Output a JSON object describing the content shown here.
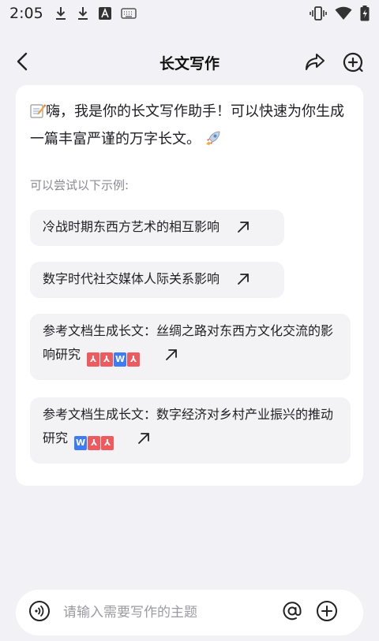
{
  "status_bar": {
    "time": "2:05",
    "left_icons": [
      "download-icon",
      "download-icon",
      "text-a-icon",
      "keyboard-icon"
    ],
    "right_icons": [
      "vibrate-icon",
      "wifi-icon",
      "battery-charging-icon"
    ]
  },
  "header": {
    "title": "长文写作",
    "back_icon": "chevron-left-icon",
    "share_icon": "share-icon",
    "new_chat_icon": "new-chat-icon"
  },
  "intro": {
    "emoji": "memo-emoji",
    "text": "嗨，我是你的长文写作助手！可以快速为你生成一篇丰富严谨的万字长文。",
    "trailing_emoji": "rocket-emoji"
  },
  "examples": {
    "label": "可以尝试以下示例:",
    "items": [
      {
        "text": "冷战时期东西方艺术的相互影响"
      },
      {
        "text": "数字时代社交媒体人际关系影响"
      },
      {
        "text": "参考文档生成长文：丝绸之路对东西方文化交流的影响研究",
        "badges": [
          "pdf",
          "pdf",
          "word",
          "pdf"
        ]
      },
      {
        "text": "参考文档生成长文：数字经济对乡村产业振兴的推动研究",
        "badges": [
          "word",
          "pdf",
          "pdf"
        ]
      }
    ]
  },
  "input": {
    "placeholder": "请输入需要写作的主题",
    "voice_icon": "voice-icon",
    "at_icon": "at-icon",
    "add_icon": "plus-circle-icon"
  },
  "colors": {
    "background": "#f2f2f6",
    "card": "#ffffff",
    "chip": "#f3f3f6",
    "muted_text": "#8a8a93",
    "pdf_badge": "#ef5a5f",
    "word_badge": "#3d7cf5"
  }
}
